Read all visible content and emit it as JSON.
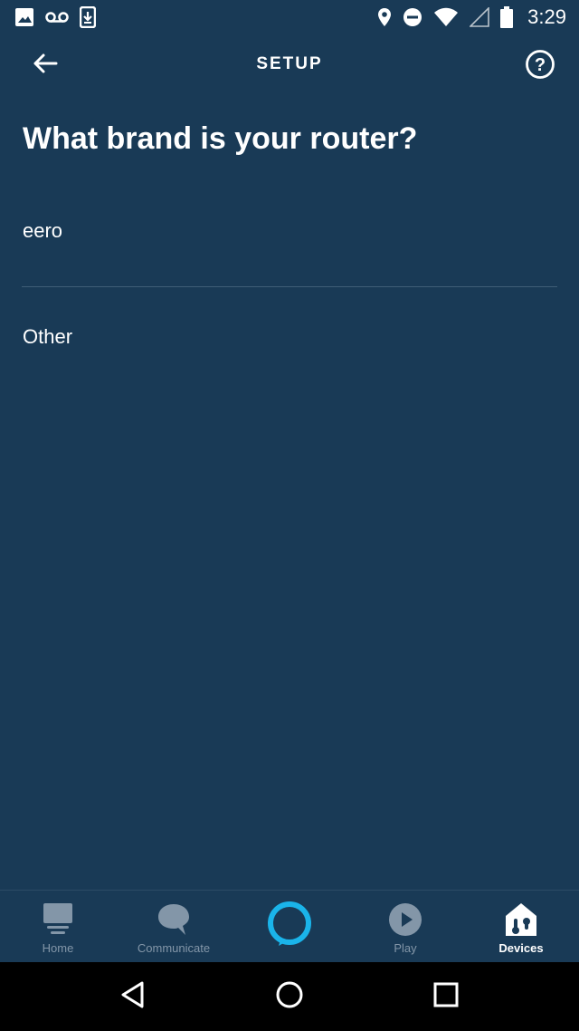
{
  "status_bar": {
    "time": "3:29",
    "icons": [
      "image-icon",
      "voicemail-icon",
      "download-icon",
      "location-icon",
      "do-not-disturb-icon",
      "wifi-icon",
      "cell-signal-icon",
      "battery-icon"
    ]
  },
  "header": {
    "title": "SETUP",
    "back_icon": "arrow-left-icon",
    "help_icon": "help-circle-icon"
  },
  "question": "What brand is your router?",
  "options": [
    {
      "label": "eero"
    },
    {
      "label": "Other"
    }
  ],
  "bottom_nav": {
    "items": [
      {
        "label": "Home",
        "icon": "home-icon",
        "active": false
      },
      {
        "label": "Communicate",
        "icon": "chat-icon",
        "active": false
      },
      {
        "label": "",
        "icon": "alexa-ring-icon",
        "active": false
      },
      {
        "label": "Play",
        "icon": "play-icon",
        "active": false
      },
      {
        "label": "Devices",
        "icon": "devices-icon",
        "active": true
      }
    ]
  },
  "colors": {
    "background": "#193a56",
    "alexa_accent": "#1ab4ea",
    "inactive_nav": "#8396a8"
  }
}
